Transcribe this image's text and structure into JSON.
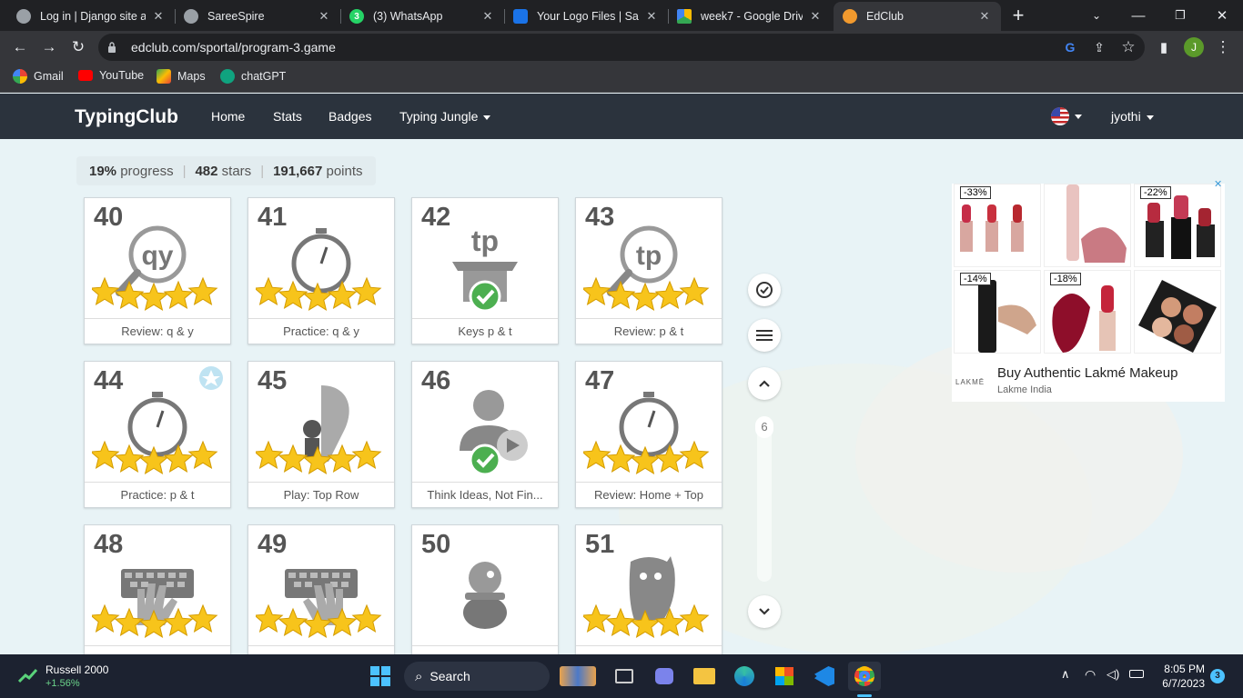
{
  "browser": {
    "tabs": [
      {
        "title": "Log in | Django site admin",
        "favicon": "globe-icon"
      },
      {
        "title": "SareeSpire",
        "favicon": "globe-icon"
      },
      {
        "title": "(3) WhatsApp",
        "favicon": "whatsapp-icon"
      },
      {
        "title": "Your Logo Files | Saree",
        "favicon": "logo-files-icon"
      },
      {
        "title": "week7 - Google Drive",
        "favicon": "google-drive-icon"
      },
      {
        "title": "EdClub",
        "favicon": "edclub-icon"
      }
    ],
    "active_tab": 5,
    "url": "edclub.com/sportal/program-3.game",
    "profile_initial": "J",
    "bookmarks": [
      {
        "label": "Gmail",
        "icon": "google-icon"
      },
      {
        "label": "YouTube",
        "icon": "youtube-icon"
      },
      {
        "label": "Maps",
        "icon": "maps-icon"
      },
      {
        "label": "chatGPT",
        "icon": "chatgpt-icon"
      }
    ]
  },
  "site": {
    "logo": "TypingClub",
    "nav": [
      "Home",
      "Stats",
      "Badges",
      "Typing Jungle"
    ],
    "user": "jyothi",
    "language_flag": "us-flag-icon"
  },
  "stats": {
    "progress": "19%",
    "progress_label": "progress",
    "stars": "482",
    "stars_label": "stars",
    "points": "191,667",
    "points_label": "points"
  },
  "lessons": [
    {
      "num": "40",
      "label": "Review: q & y",
      "icon": "magnifier-qy-icon",
      "stars": 5
    },
    {
      "num": "41",
      "label": "Practice: q & y",
      "icon": "stopwatch-icon",
      "stars": 5
    },
    {
      "num": "42",
      "label": "Keys p & t",
      "icon": "box-tp-icon",
      "stars": 0,
      "completed": true
    },
    {
      "num": "43",
      "label": "Review: p & t",
      "icon": "magnifier-tp-icon",
      "stars": 5
    },
    {
      "num": "44",
      "label": "Practice: p & t",
      "icon": "stopwatch-icon",
      "stars": 5,
      "badge": true
    },
    {
      "num": "45",
      "label": "Play: Top Row",
      "icon": "game-runner-icon",
      "stars": 5
    },
    {
      "num": "46",
      "label": "Think Ideas, Not Fin...",
      "icon": "video-person-icon",
      "stars": 0,
      "completed": true
    },
    {
      "num": "47",
      "label": "Review: Home + Top",
      "icon": "stopwatch-icon",
      "stars": 5
    },
    {
      "num": "48",
      "label": "",
      "icon": "keyboard-hands-icon",
      "stars": 5
    },
    {
      "num": "49",
      "label": "",
      "icon": "keyboard-hands-icon",
      "stars": 5
    },
    {
      "num": "50",
      "label": "",
      "icon": "pot-character-icon",
      "stars": 0
    },
    {
      "num": "51",
      "label": "",
      "icon": "monster-icon",
      "stars": 5
    }
  ],
  "side_controls": {
    "scroll_value": "6"
  },
  "ad": {
    "discounts": [
      "-33%",
      "-22%",
      "-14%",
      "-18%"
    ],
    "title": "Buy Authentic Lakmé Makeup",
    "advertiser": "Lakme India",
    "brand": "LAKMĒ"
  },
  "taskbar": {
    "stock_name": "Russell 2000",
    "stock_change": "+1.56%",
    "search_label": "Search",
    "time": "8:05 PM",
    "date": "6/7/2023",
    "notifications": "3"
  },
  "colors": {
    "header_bg": "#2b333d",
    "star": "#f7c41b",
    "check_green": "#4caf50"
  }
}
